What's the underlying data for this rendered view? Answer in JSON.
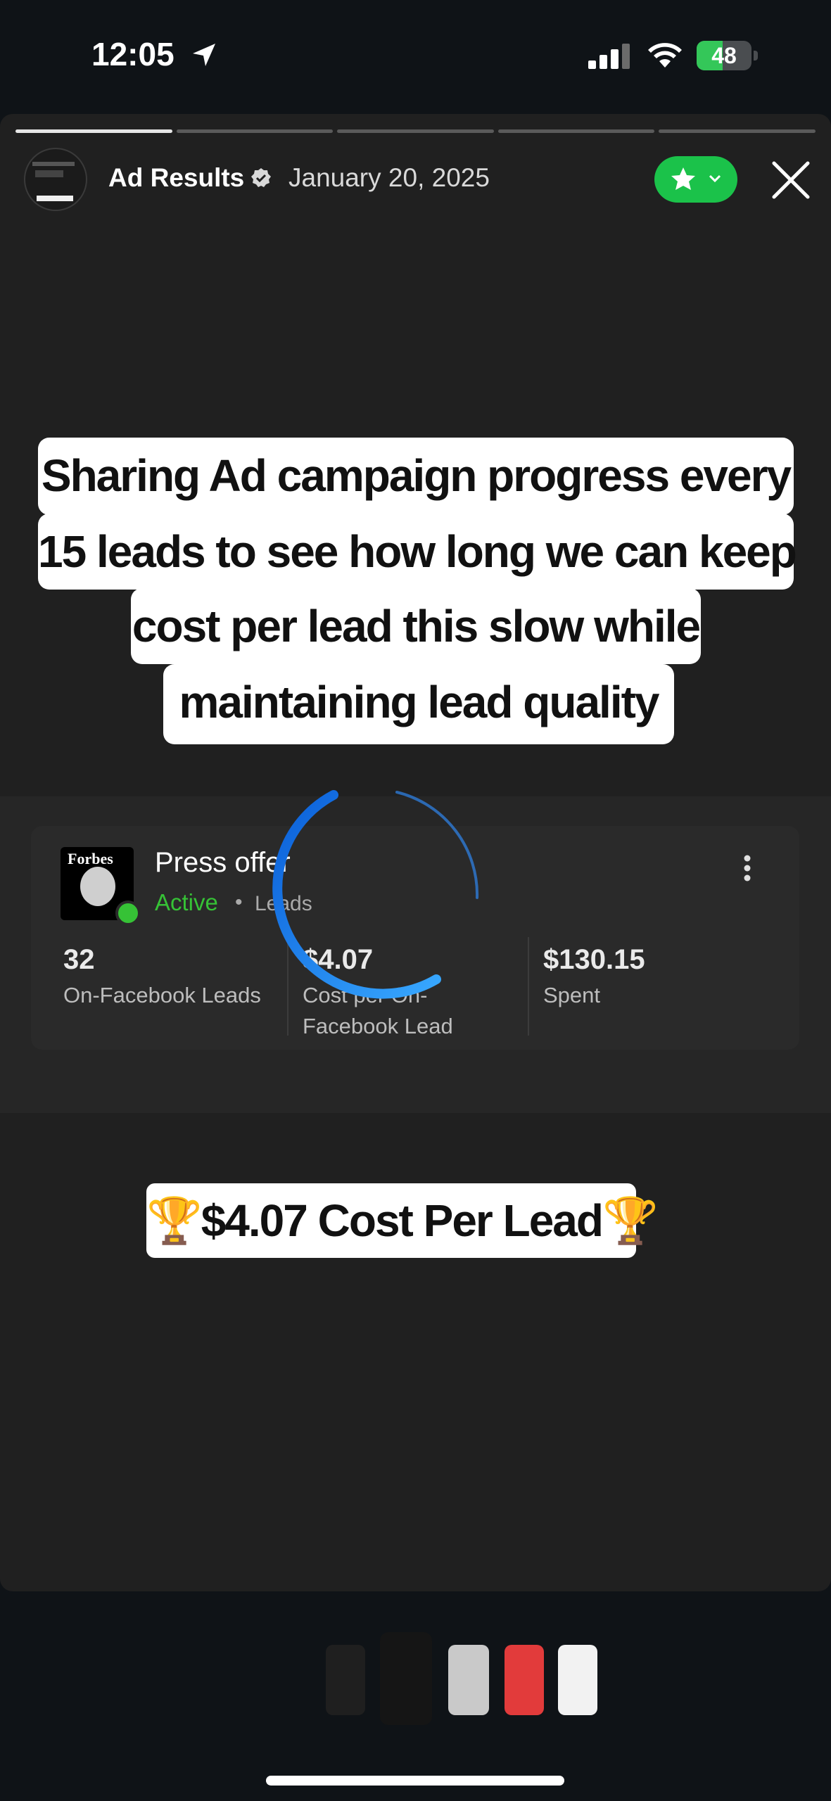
{
  "status_bar": {
    "time": "12:05",
    "battery": "48",
    "battery_level": 0.48,
    "battery_color": "#34c759"
  },
  "story": {
    "progress_segments": 5,
    "current_segment": 1,
    "page_name": "Ad Results",
    "date": "January 20, 2025",
    "accent_color": "#1bc24a"
  },
  "caption": {
    "line1": "Sharing Ad campaign progress every",
    "line2": "15 leads to see how long we can keep",
    "line3": "cost per lead this slow while",
    "line4": "maintaining lead  quality"
  },
  "ad": {
    "thumb_brand": "Forbes",
    "name": "Press offer",
    "status": "Active",
    "separator": "•",
    "type": "Leads",
    "status_color": "#36c236",
    "metrics": [
      {
        "value": "32",
        "label": "On-Facebook Leads"
      },
      {
        "value": "$4.07",
        "label": "Cost per On-Facebook Lead"
      },
      {
        "value": "$130.15",
        "label": "Spent"
      }
    ]
  },
  "banner": {
    "text": "🏆$4.07 Cost Per Lead🏆"
  },
  "thumbnails": {
    "count": 5,
    "selected": 2
  }
}
